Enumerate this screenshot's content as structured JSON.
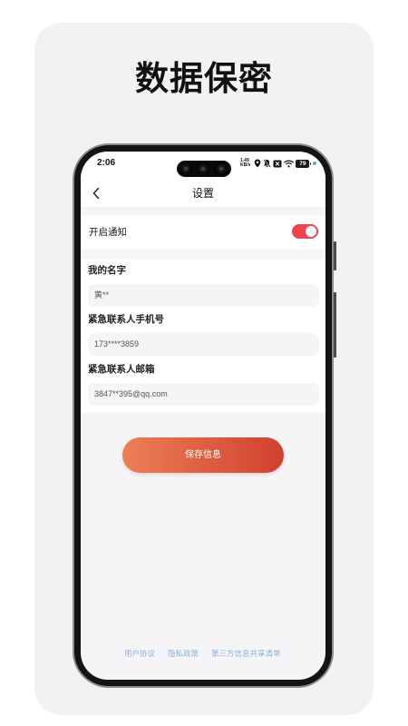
{
  "promo": {
    "title": "数据保密"
  },
  "status_bar": {
    "time": "2:06",
    "net_speed_value": "1.49",
    "net_speed_unit": "KB/s",
    "battery": "79",
    "icons": [
      "location-icon",
      "mute-icon",
      "no-sim-icon",
      "wifi-icon",
      "battery-icon",
      "green-dot-icon"
    ]
  },
  "nav": {
    "back_icon": "chevron-left-icon",
    "title": "设置"
  },
  "settings": {
    "notification": {
      "label": "开启通知",
      "enabled": true
    }
  },
  "profile": {
    "fields": [
      {
        "label": "我的名字",
        "value": "黄**"
      },
      {
        "label": "紧急联系人手机号",
        "value": "173****3859"
      },
      {
        "label": "紧急联系人邮箱",
        "value": "3847**395@qq.com"
      }
    ]
  },
  "actions": {
    "save_label": "保存信息"
  },
  "footer": {
    "links": [
      "用户协议",
      "隐私政策",
      "第三方信息共享清单"
    ]
  },
  "colors": {
    "toggle_on": "#f0434b",
    "button_start": "#ec7f56",
    "button_end": "#d0402f",
    "footer_link": "#8ab0d9",
    "promo_card": "#f1f2f4"
  }
}
